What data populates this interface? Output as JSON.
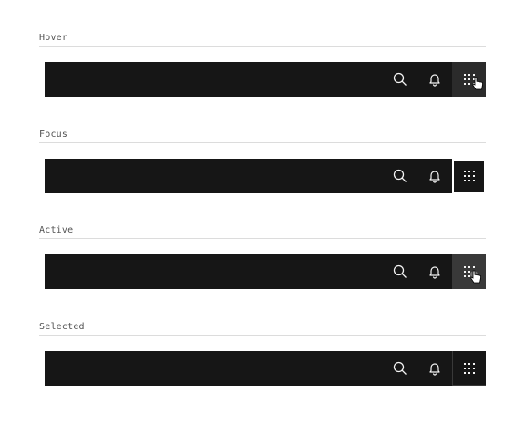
{
  "states": [
    {
      "label": "Hover",
      "variant": "hover"
    },
    {
      "label": "Focus",
      "variant": "focus"
    },
    {
      "label": "Active",
      "variant": "active"
    },
    {
      "label": "Selected",
      "variant": "selected"
    }
  ],
  "icons": {
    "search": "search-icon",
    "notifications": "bell-icon",
    "app_switcher": "app-switcher-grid-icon",
    "pointer": "hand-pointer-cursor-icon"
  },
  "colors": {
    "header_bg": "#161616",
    "icon": "#f4f4f4",
    "hover_bg": "#2b2b2b",
    "active_bg": "#393939",
    "focus_ring": "#ffffff",
    "label_text": "#525252",
    "divider": "#dcdcdc"
  }
}
